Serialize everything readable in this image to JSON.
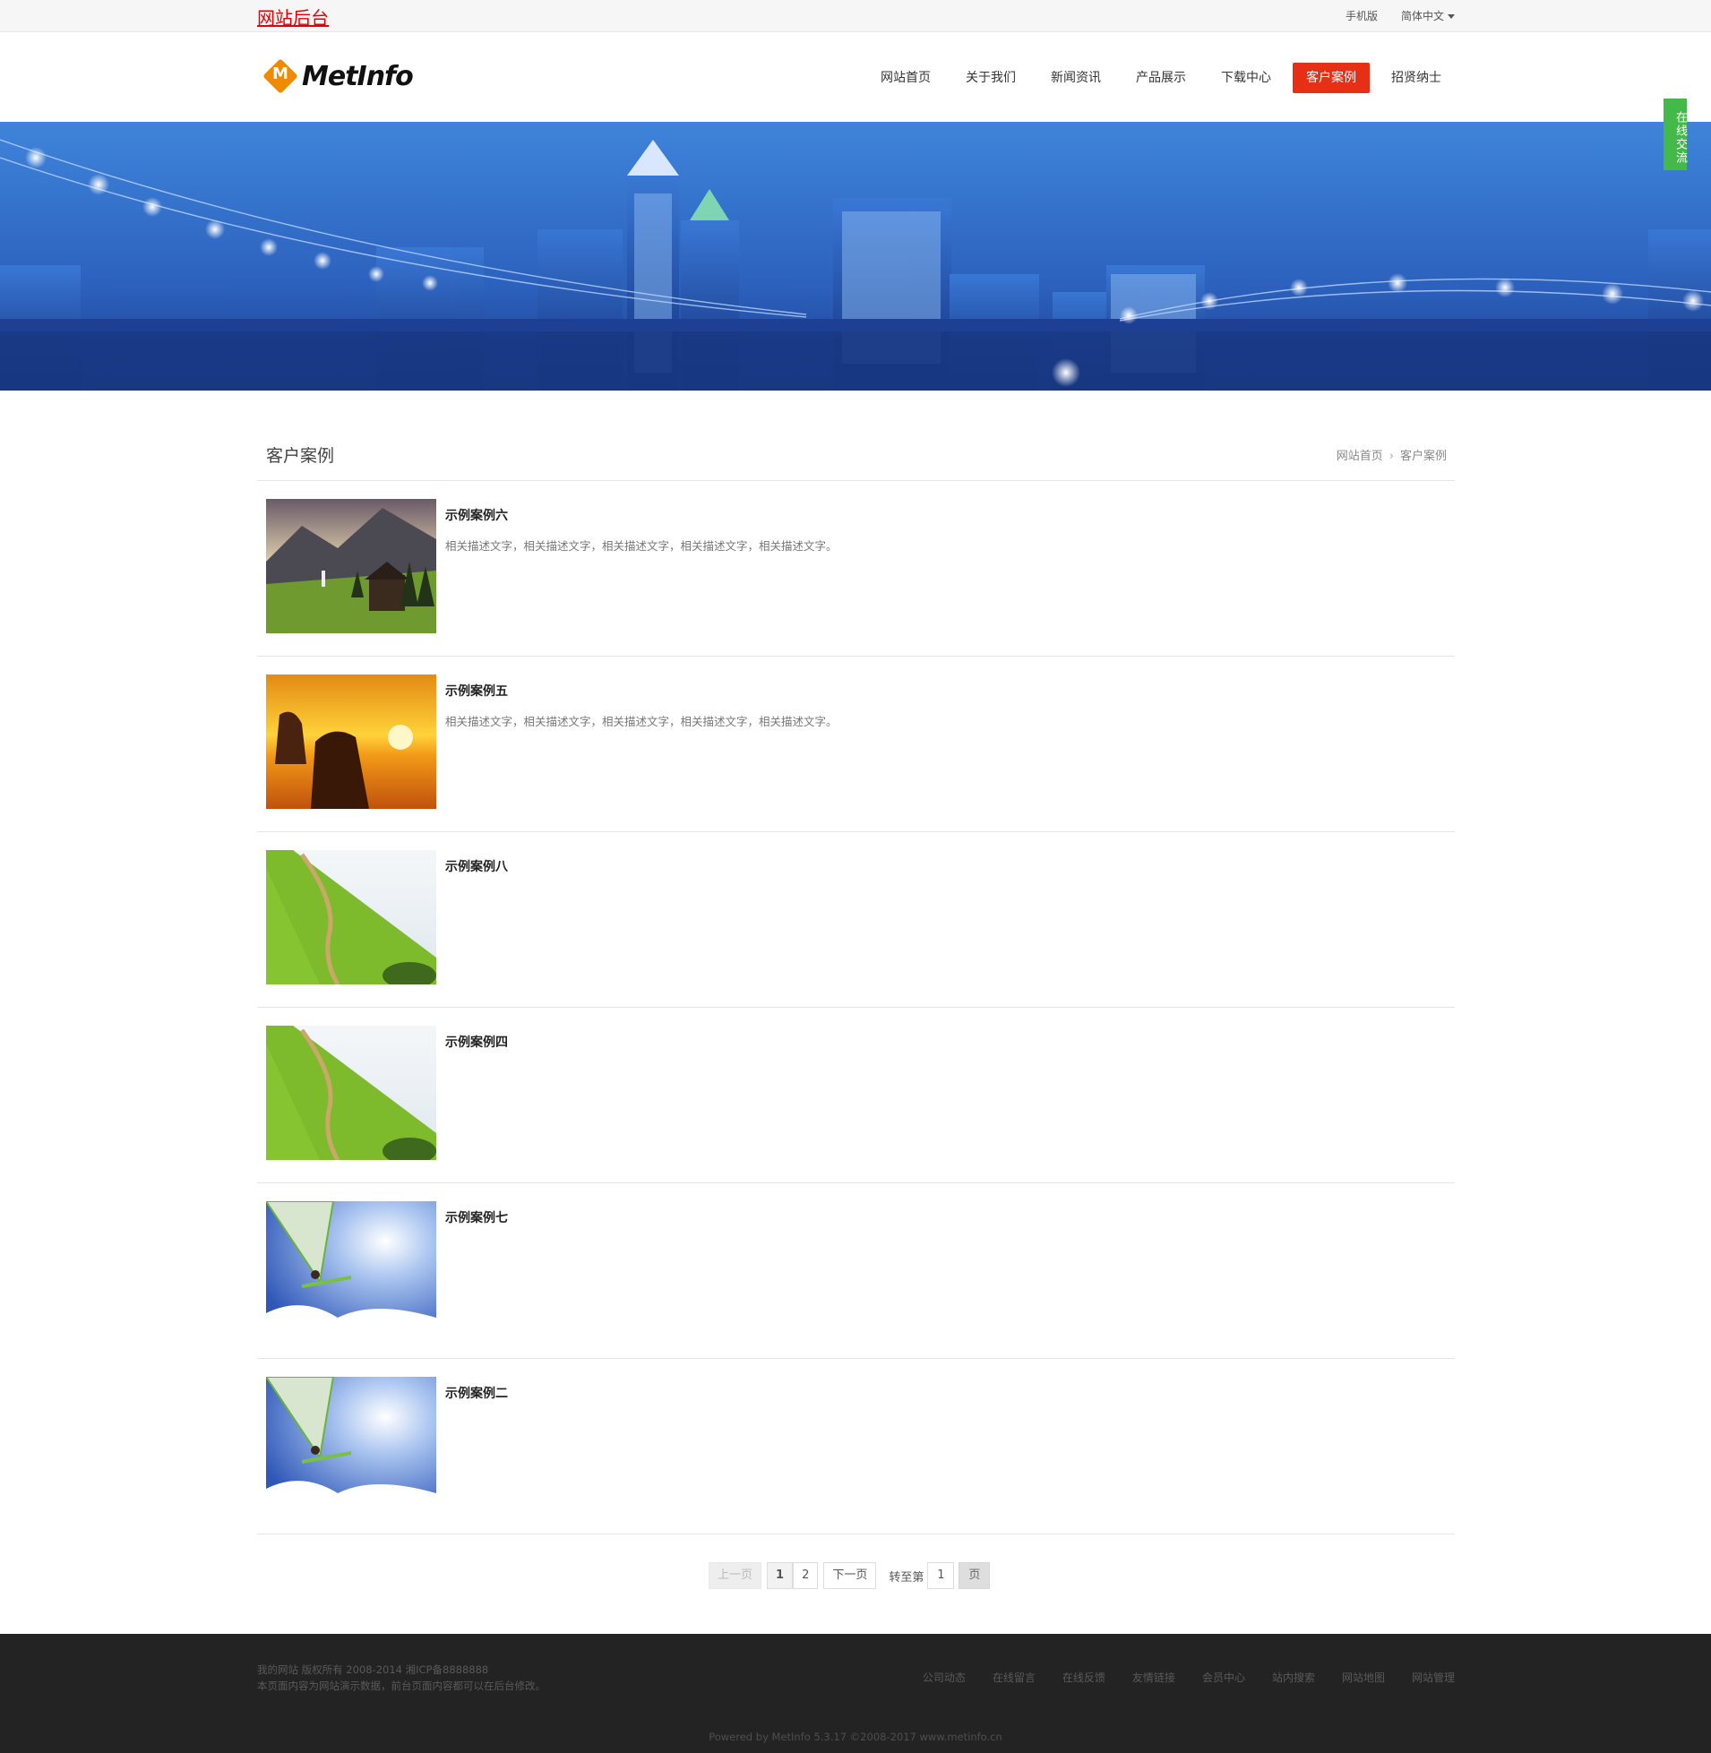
{
  "topbar": {
    "admin_link": "网站后台",
    "mobile": "手机版",
    "language": "简体中文"
  },
  "header": {
    "logo_text": "MetInfo",
    "logo_mark": "M",
    "nav": [
      {
        "label": "网站首页",
        "active": false
      },
      {
        "label": "关于我们",
        "active": false
      },
      {
        "label": "新闻资讯",
        "active": false
      },
      {
        "label": "产品展示",
        "active": false
      },
      {
        "label": "下载中心",
        "active": false
      },
      {
        "label": "客户案例",
        "active": true
      },
      {
        "label": "招贤纳士",
        "active": false
      }
    ]
  },
  "side_chat": "在线交流",
  "page": {
    "title": "客户案例",
    "breadcrumb": [
      "网站首页",
      "客户案例"
    ]
  },
  "cases": [
    {
      "title": "示例案例六",
      "desc": "相关描述文字，相关描述文字，相关描述文字，相关描述文字，相关描述文字。",
      "image": "mountain-village"
    },
    {
      "title": "示例案例五",
      "desc": "相关描述文字，相关描述文字，相关描述文字，相关描述文字，相关描述文字。",
      "image": "sunset-rocks"
    },
    {
      "title": "示例案例八",
      "desc": "",
      "image": "green-hill-path"
    },
    {
      "title": "示例案例四",
      "desc": "",
      "image": "green-hill-path"
    },
    {
      "title": "示例案例七",
      "desc": "",
      "image": "windsurfer"
    },
    {
      "title": "示例案例二",
      "desc": "",
      "image": "windsurfer"
    }
  ],
  "pager": {
    "prev": "上一页",
    "pages": [
      "1",
      "2"
    ],
    "current": "1",
    "next": "下一页",
    "goto": "转至第",
    "goto_value": "1",
    "go": "页"
  },
  "footer": {
    "line1": "我的网站 版权所有 2008-2014 湘ICP备8888888",
    "line2": "本页面内容为网站演示数据，前台页面内容都可以在后台修改。",
    "links": [
      "公司动态",
      "在线留言",
      "在线反馈",
      "友情链接",
      "会员中心",
      "站内搜索",
      "网站地图",
      "网站管理"
    ],
    "powered": "Powered by MetInfo 5.3.17 ©2008-2017 www.metinfo.cn"
  },
  "colors": {
    "accent": "#e62f17",
    "admin_link": "#e60000",
    "chat": "#43b949",
    "footer_bg": "#232323"
  }
}
